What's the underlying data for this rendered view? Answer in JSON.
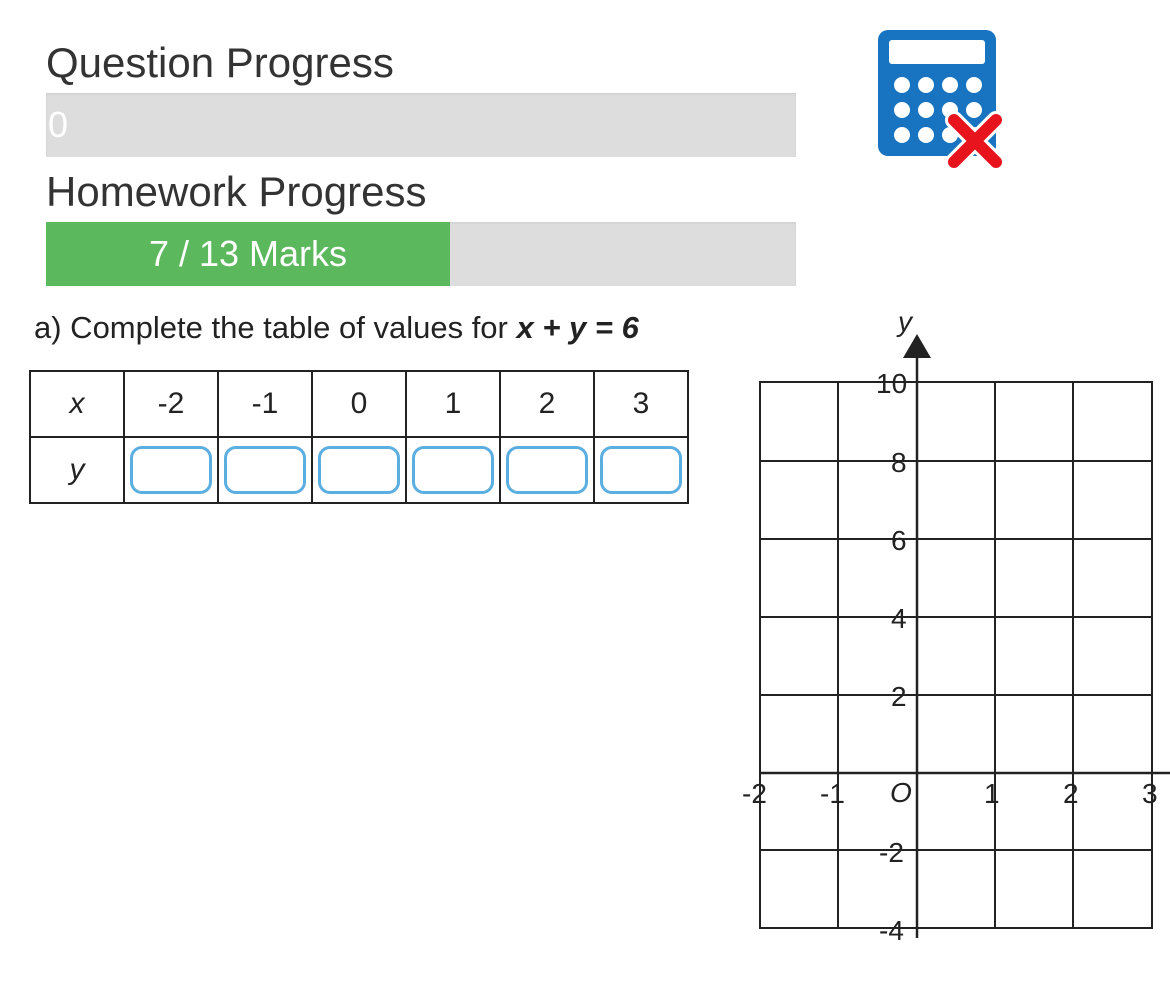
{
  "progress": {
    "question_label": "Question Progress",
    "question_value": "0",
    "question_fraction": 0,
    "homework_label": "Homework Progress",
    "homework_value": "7 / 13 Marks",
    "homework_fraction": 0.538,
    "fill_color": "#5cb85c"
  },
  "calculator": {
    "icon": "calculator-not-allowed-icon",
    "color": "#1874c1",
    "cross_color": "#e8141d"
  },
  "question": {
    "prefix": "a) Complete the table of values for ",
    "equation": "x + y = 6"
  },
  "table": {
    "x_header": "x",
    "y_header": "y",
    "x_values": [
      "-2",
      "-1",
      "0",
      "1",
      "2",
      "3"
    ],
    "answers": [
      "",
      "",
      "",
      "",
      "",
      ""
    ]
  },
  "graph": {
    "y_axis_label": "y",
    "origin_label": "O",
    "x_tick_labels": [
      "-2",
      "-1",
      "1",
      "2",
      "3"
    ],
    "y_tick_labels": [
      "10",
      "8",
      "6",
      "4",
      "2",
      "-2",
      "-4"
    ]
  }
}
